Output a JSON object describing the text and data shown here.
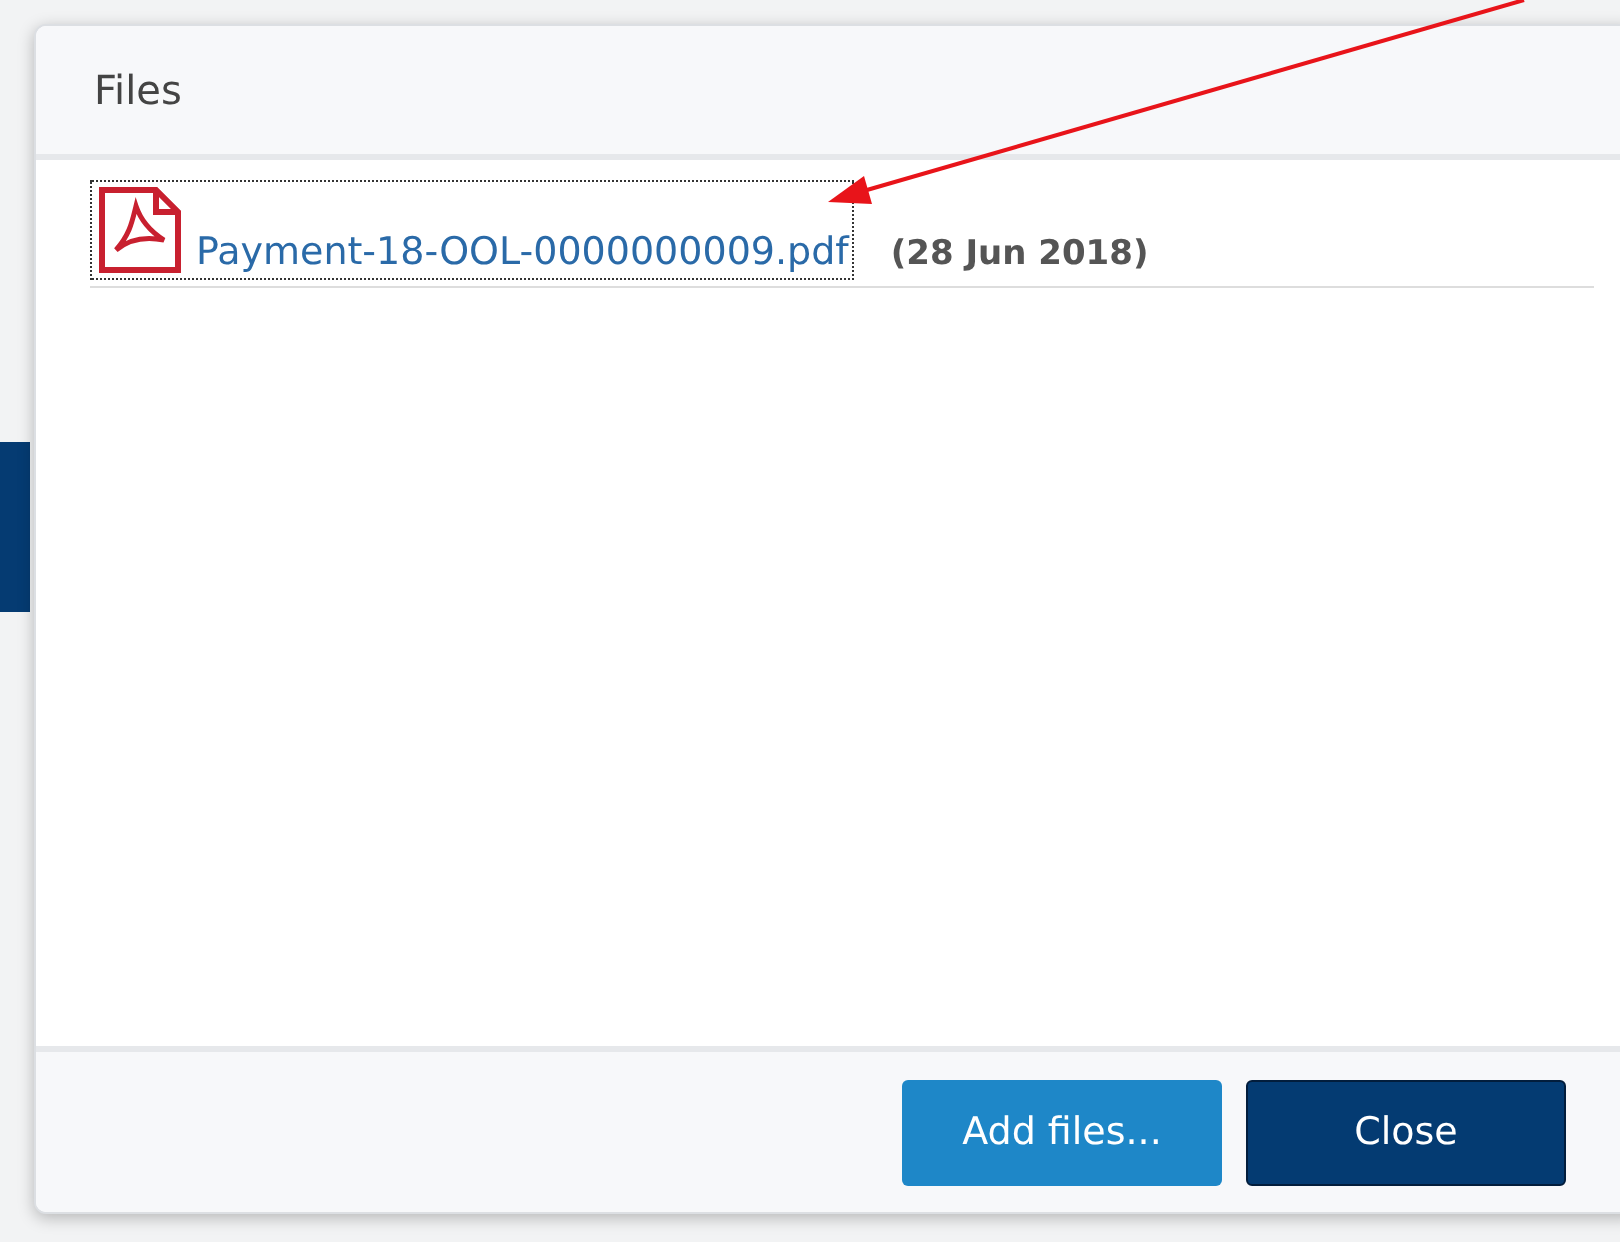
{
  "dialog": {
    "title": "Files"
  },
  "files": [
    {
      "name": "Payment-18-OOL-0000000009.pdf",
      "date": "(28 Jun 2018)",
      "focused": true
    }
  ],
  "buttons": [
    {
      "label": "Add files...",
      "kind": "secondary"
    },
    {
      "label": "Close",
      "kind": "primary"
    }
  ]
}
